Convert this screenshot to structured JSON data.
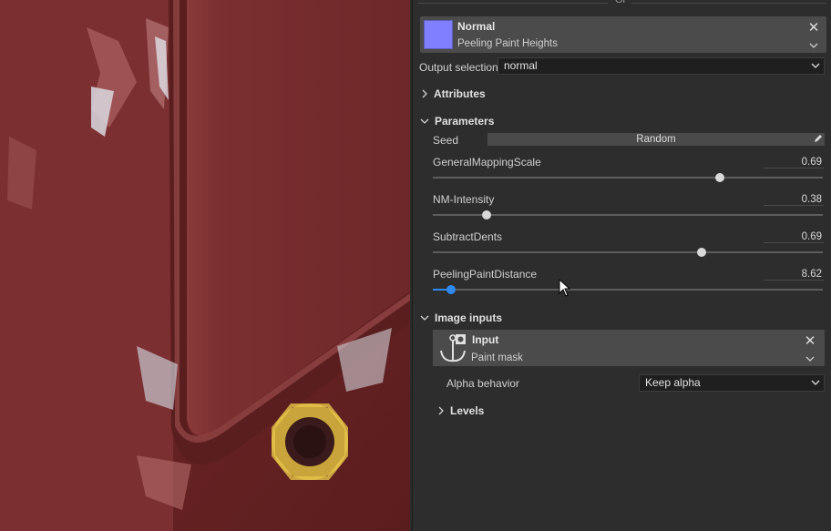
{
  "header": {
    "or_label": "Or"
  },
  "layer": {
    "title": "Normal",
    "subtitle": "Peeling Paint Heights",
    "swatch_color": "#7f7fff"
  },
  "output_selection": {
    "label": "Output selection",
    "value": "normal"
  },
  "sections": {
    "attributes": "Attributes",
    "parameters": "Parameters",
    "image_inputs": "Image inputs",
    "levels": "Levels"
  },
  "parameters": {
    "seed": {
      "label": "Seed",
      "button": "Random"
    },
    "sliders": [
      {
        "label": "GeneralMappingScale",
        "value": "0.69",
        "position": 0.685
      },
      {
        "label": "NM-Intensity",
        "value": "0.38",
        "position": 0.137
      },
      {
        "label": "SubtractDents",
        "value": "0.69",
        "position": 0.69
      },
      {
        "label": "PeelingPaintDistance",
        "value": "8.62",
        "position": 0.047
      }
    ]
  },
  "image_input": {
    "title": "Input",
    "subtitle": "Paint mask",
    "alpha_label": "Alpha behavior",
    "alpha_value": "Keep alpha"
  },
  "colors": {
    "accent": "#2f8af0",
    "panel": "#2d2d2d",
    "card": "#4b4b4b"
  }
}
